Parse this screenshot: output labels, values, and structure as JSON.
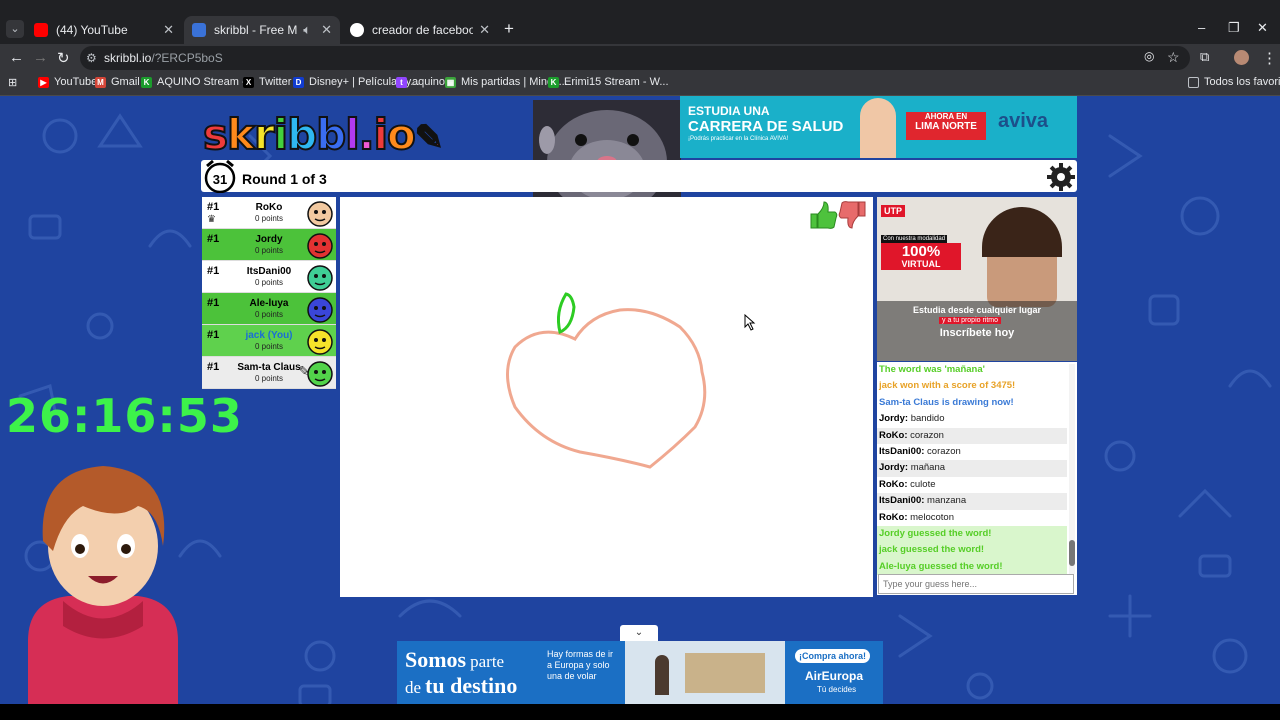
{
  "browser": {
    "tabs": [
      {
        "title": "(44) YouTube",
        "active": false
      },
      {
        "title": "skribbl - Free Multiplayer D",
        "active": true
      },
      {
        "title": "creador de facebook - Buscar c",
        "active": false
      }
    ],
    "url_host": "skribbl.io",
    "url_path": "/?ERCP5boS",
    "bookmarks": [
      "YouTube",
      "Gmail",
      "AQUINO Stream -...",
      "Twitter",
      "Disney+ | Películas y...",
      "aquino",
      "Mis partidas | Minec...",
      "Erimi15 Stream - W..."
    ],
    "all_bookmarks": "Todos los favoritos"
  },
  "game": {
    "logo": "skribbl.io",
    "timer_seconds": "31",
    "round_text": "Round 1 of 3",
    "players": [
      {
        "rank": "#1",
        "name": "RoKo",
        "points": "0 points",
        "guessed": false,
        "color": "#f2c9a0"
      },
      {
        "rank": "#1",
        "name": "Jordy",
        "points": "0 points",
        "guessed": true,
        "color": "#e23232"
      },
      {
        "rank": "#1",
        "name": "ItsDani00",
        "points": "0 points",
        "guessed": false,
        "color": "#3fcf96"
      },
      {
        "rank": "#1",
        "name": "Ale-luya",
        "points": "0 points",
        "guessed": true,
        "color": "#3a46d8"
      },
      {
        "rank": "#1",
        "name": "jack (You)",
        "points": "0 points",
        "guessed": true,
        "color": "#f5e32a"
      },
      {
        "rank": "#1",
        "name": "Sam-ta Claus",
        "points": "0 points",
        "guessed": false,
        "color": "#52d34a"
      }
    ],
    "chat": [
      {
        "type": "green",
        "author": "",
        "text": "The word was 'mañana'"
      },
      {
        "type": "orange",
        "author": "",
        "text": "jack won with a score of 3475!"
      },
      {
        "type": "blue",
        "author": "",
        "text": "Sam-ta Claus is drawing now!"
      },
      {
        "type": "msg",
        "author": "Jordy:",
        "text": "bandido"
      },
      {
        "type": "msg",
        "author": "RoKo:",
        "text": "corazon"
      },
      {
        "type": "msg",
        "author": "ItsDani00:",
        "text": "corazon"
      },
      {
        "type": "msg",
        "author": "Jordy:",
        "text": "mañana"
      },
      {
        "type": "msg",
        "author": "RoKo:",
        "text": "culote"
      },
      {
        "type": "msg",
        "author": "ItsDani00:",
        "text": "manzana"
      },
      {
        "type": "msg",
        "author": "RoKo:",
        "text": "melocoton"
      },
      {
        "type": "greenbg",
        "author": "",
        "text": "Jordy guessed the word!"
      },
      {
        "type": "greenbg",
        "author": "",
        "text": "jack guessed the word!"
      },
      {
        "type": "greenbg",
        "author": "",
        "text": "Ale-luya guessed the word!"
      }
    ],
    "guess_placeholder": "Type your guess here..."
  },
  "stream_overlay": {
    "uptime": "26:16:53"
  },
  "ads": {
    "top": {
      "line1": "ESTUDIA UNA",
      "line2": "CARRERA DE SALUD",
      "line3": "¡Podrás practicar en la Clínica AVIVA!",
      "badge1": "AHORA EN",
      "badge2": "LIMA NORTE",
      "brand": "aviva"
    },
    "side": {
      "brand": "UTP",
      "line1": "Con nuestra modalidad",
      "pct": "100%",
      "virtual": "VIRTUAL",
      "line2": "Estudia desde cualquier lugar",
      "line3": "y a tu propio ritmo",
      "cta": "Inscríbete hoy"
    },
    "bottom": {
      "big1": "Somos",
      "small1": "parte",
      "small2": "de",
      "big2": "tu destino",
      "mid": "Hay formas de ir a Europa y solo una de volar",
      "cta": "¡Compra ahora!",
      "brand": "AirEuropa",
      "tag": "Tú decides"
    }
  },
  "colors": {
    "page_bg": "#1f44a0",
    "guessed_green": "#5fd14d",
    "timer_green": "#3df24a",
    "chat_green": "#56ce27"
  },
  "icons": [
    "tab-list-icon",
    "youtube-icon",
    "sound-icon",
    "close-icon",
    "new-tab-icon",
    "back-icon",
    "forward-icon",
    "reload-icon",
    "site-info-icon",
    "eye-off-icon",
    "star-icon",
    "extensions-icon",
    "profile-icon",
    "menu-icon",
    "apps-icon",
    "folder-icon",
    "alarm-clock-icon",
    "settings-gear-icon",
    "crown-icon",
    "pencil-icon",
    "thumbs-up-icon",
    "thumbs-down-icon",
    "chevron-down-icon",
    "cursor-icon"
  ]
}
